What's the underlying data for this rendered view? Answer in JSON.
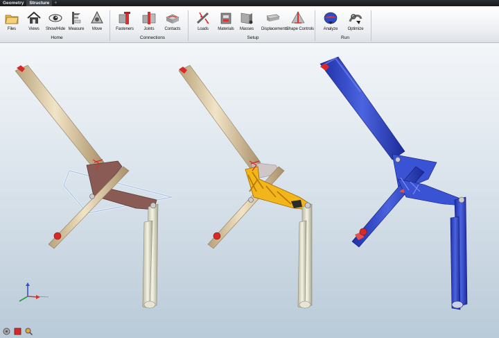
{
  "tabs": [
    {
      "label": "Geometry",
      "active": false
    },
    {
      "label": "Structure",
      "active": true
    }
  ],
  "tab_add_symbol": "+",
  "toolbar": {
    "files": "Files",
    "views": "Views",
    "show_hide": "Show/Hide",
    "measure": "Measure",
    "move": "Move",
    "fasteners": "Fasteners",
    "joints": "Joints",
    "contacts": "Contacts",
    "loads": "Loads",
    "materials": "Materials",
    "masses": "Masses",
    "displacements": "Displacements",
    "shape_controls": "Shape Controls",
    "analyze": "Analyze",
    "optimize": "Optimize"
  },
  "groups": {
    "home": "Home",
    "connections": "Connections",
    "setup": "Setup",
    "run": "Run"
  },
  "colors": {
    "tube": "#e4d4b2",
    "bracket_design_space": "#8a5a55",
    "bracket_optimized": "#f2b51c",
    "analysis_blue": "#3048c8",
    "load_marker": "#d62a2a"
  },
  "icons": [
    "folder-icon",
    "house-icon",
    "eye-icon",
    "caliper-icon",
    "move-icon",
    "bolt-icon",
    "joint-icon",
    "contact-icon",
    "load-icon",
    "material-icon",
    "mass-icon",
    "displacement-icon",
    "shape-control-icon",
    "analyze-icon",
    "optimize-icon",
    "axis-triad-icon",
    "bottom-tool-icons"
  ]
}
